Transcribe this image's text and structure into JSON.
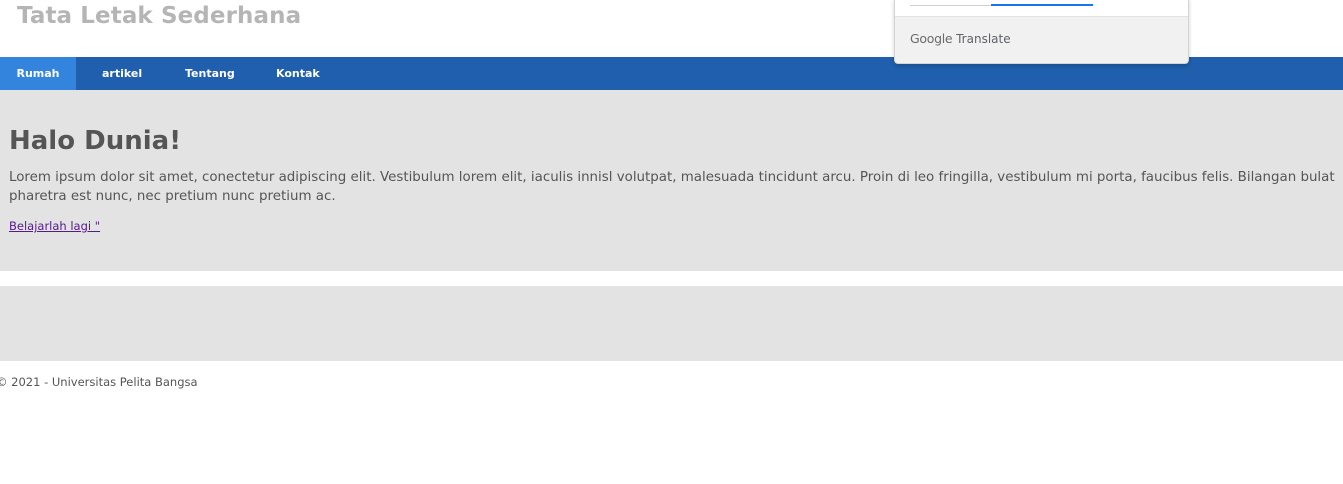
{
  "site": {
    "title": "Tata Letak Sederhana"
  },
  "nav": {
    "items": [
      {
        "label": "Rumah",
        "active": true
      },
      {
        "label": "artikel",
        "active": false
      },
      {
        "label": "Tentang",
        "active": false
      },
      {
        "label": "Kontak",
        "active": false
      }
    ]
  },
  "hero": {
    "heading": "Halo Dunia!",
    "body": "Lorem ipsum dolor sit amet, conectetur adipiscing elit. Vestibulum lorem elit, iaculis innisl volutpat, malesuada tincidunt arcu. Proin di leo fringilla, vestibulum mi porta, faucibus felis. Bilangan bulat pharetra est nunc, nec pretium nunc pretium ac.",
    "link_label": "Belajarlah lagi \""
  },
  "footer": {
    "text": "© 2021 - Universitas Pelita Bangsa"
  },
  "translate_widget": {
    "brand": "Google",
    "product": "Translate"
  },
  "colors": {
    "nav_background": "#1f5fad",
    "nav_active": "#3384dd",
    "hero_background": "#e3e3e3",
    "link_visited": "#551a8b",
    "translate_accent": "#1a73e8"
  }
}
